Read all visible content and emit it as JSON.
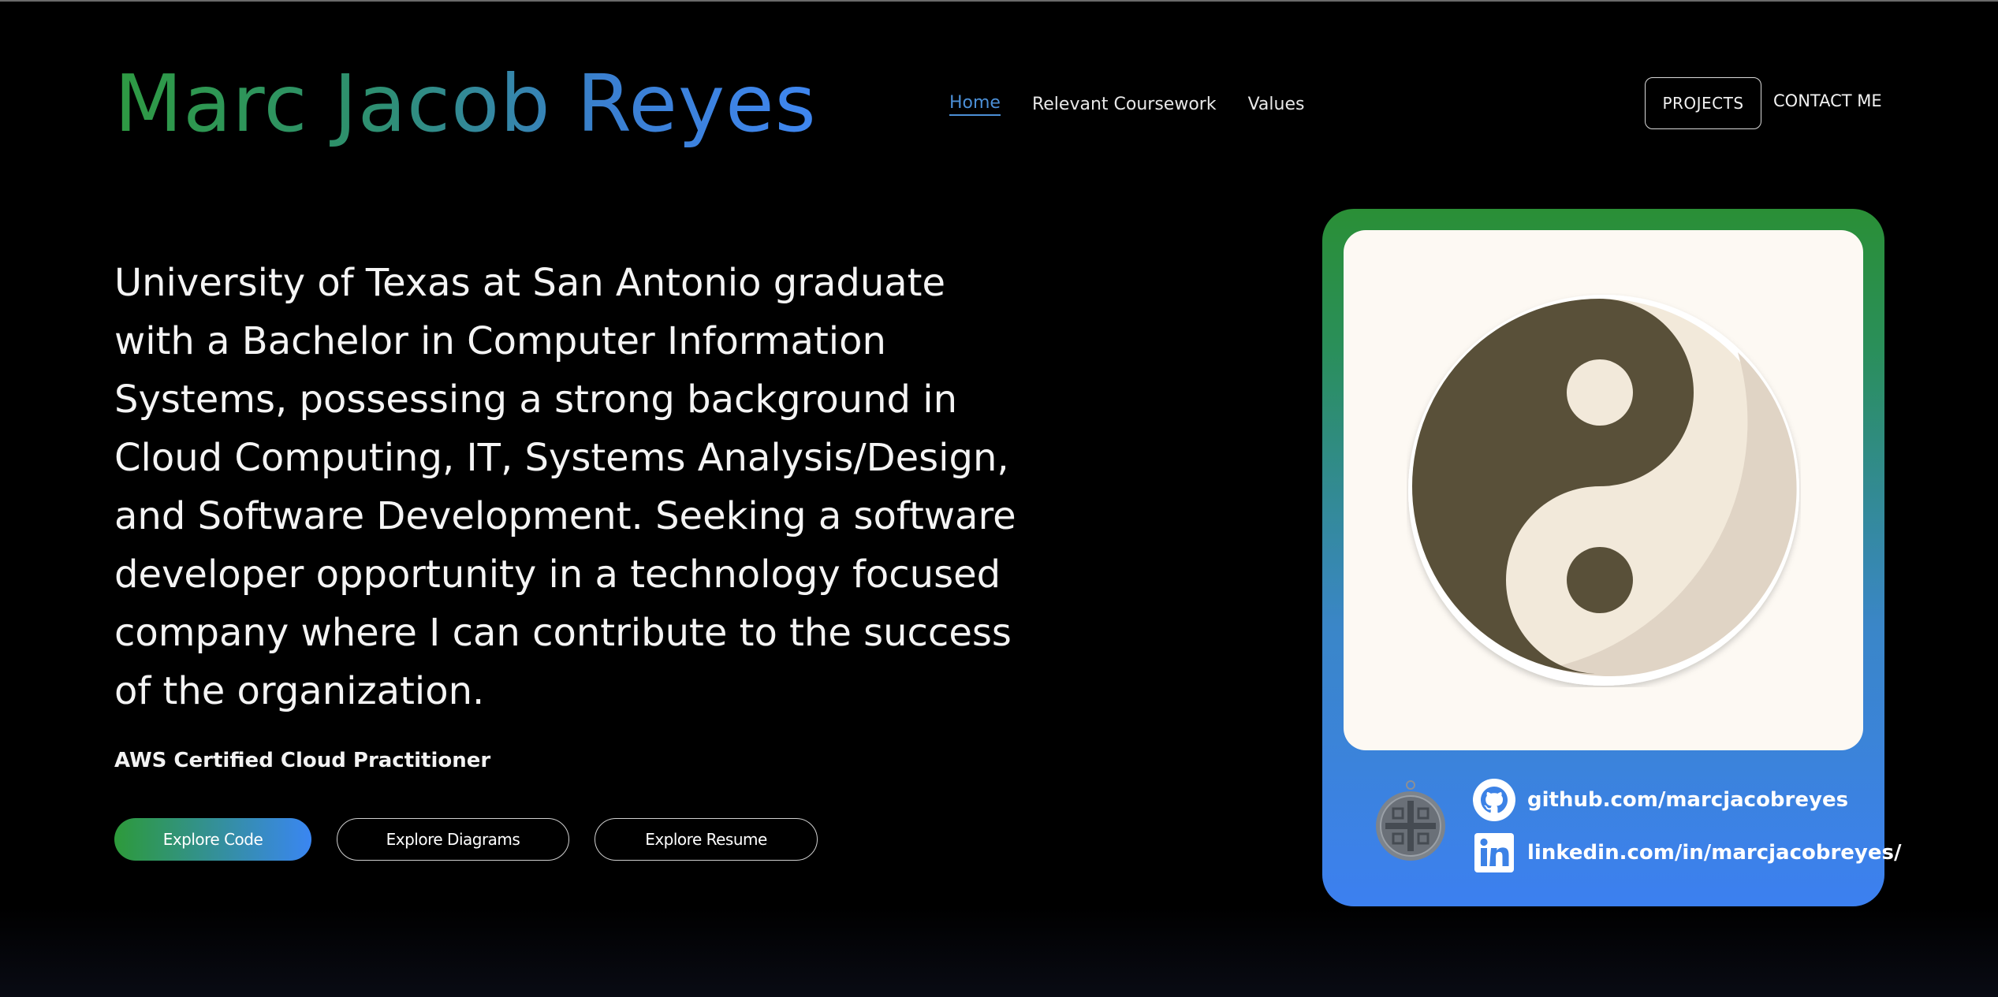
{
  "header": {
    "name": "Marc Jacob Reyes",
    "nav": {
      "home": "Home",
      "coursework": "Relevant Coursework",
      "values": "Values"
    },
    "projects_label": "PROJECTS",
    "contact_label": "CONTACT ME"
  },
  "hero": {
    "bio": "University of Texas at San Antonio graduate with a Bachelor in Computer Information Systems, possessing a strong background in Cloud Computing, IT, Systems Analysis/Design, and Software Development. Seeking a software developer opportunity in a technology focused company where I can contribute to the success of the organization.",
    "certification": "AWS Certified Cloud Practitioner",
    "buttons": {
      "code": "Explore Code",
      "diagrams": "Explore Diagrams",
      "resume": "Explore Resume"
    }
  },
  "profile_card": {
    "image_icon": "yin-yang-icon",
    "badge_icon": "coin-icon",
    "github": {
      "icon": "github-icon",
      "text": "github.com/marcjacobreyes"
    },
    "linkedin": {
      "icon": "linkedin-icon",
      "text": "linkedin.com/in/marcjacobreyes/"
    }
  },
  "colors": {
    "background": "#000000",
    "accent_green": "#2d9a3a",
    "accent_blue": "#3a86f2",
    "link_active": "#4b8fd6"
  }
}
